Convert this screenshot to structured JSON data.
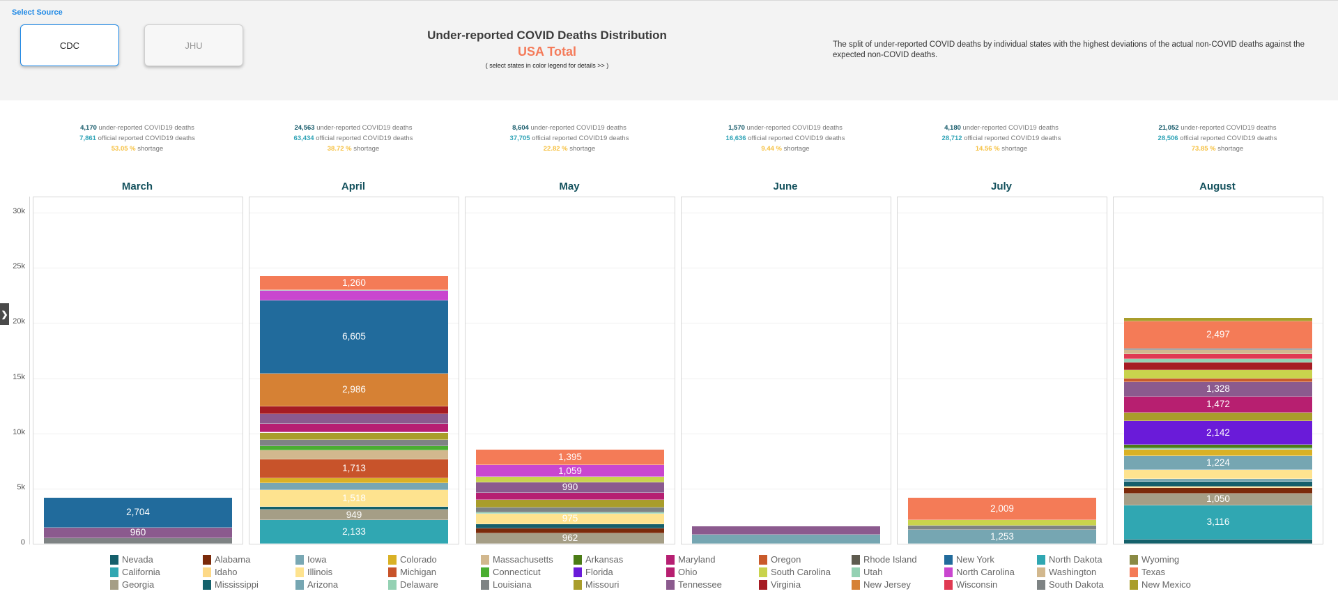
{
  "header": {
    "select_source_label": "Select Source",
    "sources": [
      {
        "label": "CDC",
        "selected": true
      },
      {
        "label": "JHU",
        "selected": false
      }
    ],
    "title": "Under-reported COVID Deaths Distribution",
    "subtitle": "USA Total",
    "hint": "( select states in color legend for details >> )",
    "description": "The split of under-reported COVID deaths by individual states with the highest deviations of the actual non-COVID deaths against the expected non-COVID deaths."
  },
  "stats_labels": {
    "under": "under-reported COVID19 deaths",
    "official": "official reported COVID19 deaths",
    "shortage": "shortage",
    "percent_sign": "%"
  },
  "months": [
    {
      "name": "March",
      "under": "4,170",
      "official": "7,861",
      "shortage_pct": "53.05"
    },
    {
      "name": "April",
      "under": "24,563",
      "official": "63,434",
      "shortage_pct": "38.72"
    },
    {
      "name": "May",
      "under": "8,604",
      "official": "37,705",
      "shortage_pct": "22.82"
    },
    {
      "name": "June",
      "under": "1,570",
      "official": "16,636",
      "shortage_pct": "9.44"
    },
    {
      "name": "July",
      "under": "4,180",
      "official": "28,712",
      "shortage_pct": "14.56"
    },
    {
      "name": "August",
      "under": "21,052",
      "official": "28,506",
      "shortage_pct": "73.85"
    }
  ],
  "side_toggle_icon": "chevron-right-icon",
  "colors": {
    "accent": "#1e88e5",
    "subtitle": "#f47b5a",
    "month_title": "#12505c",
    "under_value": "#155a6a",
    "official_value": "#2fa3b6",
    "shortage_value": "#f6c142"
  },
  "chart_data": {
    "type": "bar",
    "stacked": true,
    "title": "Under-reported COVID Deaths Distribution",
    "subtitle": "USA Total",
    "ylabel": "",
    "ylim": [
      0,
      31000
    ],
    "yticks": [
      0,
      5000,
      10000,
      15000,
      20000,
      25000,
      30000
    ],
    "ytick_labels": [
      "0",
      "5k",
      "10k",
      "15k",
      "20k",
      "25k",
      "30k"
    ],
    "grid": true,
    "categories": [
      "March",
      "April",
      "May",
      "June",
      "July",
      "August"
    ],
    "legend_placement": "bottom",
    "state_colors": {
      "Nevada": "#155f6b",
      "California": "#30a7b2",
      "Georgia": "#a59e86",
      "Alabama": "#7b2a0a",
      "Idaho": "#fdd987",
      "Mississippi": "#14616b",
      "Iowa": "#79a8b4",
      "Illinois": "#fee38f",
      "Arizona": "#76a6b2",
      "Colorado": "#d9b125",
      "Michigan": "#c8532a",
      "Delaware": "#94d1b3",
      "Massachusetts": "#d2b88e",
      "Connecticut": "#4aae31",
      "Louisiana": "#7e8384",
      "Arkansas": "#4b7c16",
      "Florida": "#6a1bd9",
      "Missouri": "#a99d2b",
      "Maryland": "#b61f72",
      "Ohio": "#b71f70",
      "Tennessee": "#8b5a8e",
      "Oregon": "#c95a2b",
      "South Carolina": "#c9d34d",
      "Virginia": "#a61c23",
      "Rhode Island": "#5e5b4f",
      "Utah": "#94d1b3",
      "New Jersey": "#d68134",
      "New York": "#216b9c",
      "North Carolina": "#c946cf",
      "Wisconsin": "#e03a52",
      "North Dakota": "#30a7b2",
      "Washington": "#d2b88e",
      "South Dakota": "#7e8384",
      "Wyoming": "#8a8a44",
      "Texas": "#f47b57",
      "New Mexico": "#a99d2b"
    },
    "legend": [
      [
        "Nevada",
        "California",
        "Georgia"
      ],
      [
        "Alabama",
        "Idaho",
        "Mississippi"
      ],
      [
        "Iowa",
        "Illinois",
        "Arizona"
      ],
      [
        "Colorado",
        "Michigan",
        "Delaware"
      ],
      [
        "Massachusetts",
        "Connecticut",
        "Louisiana"
      ],
      [
        "Arkansas",
        "Florida",
        "Missouri"
      ],
      [
        "Maryland",
        "Ohio",
        "Tennessee"
      ],
      [
        "Oregon",
        "South Carolina",
        "Virginia"
      ],
      [
        "Rhode Island",
        "Utah",
        "New Jersey"
      ],
      [
        "New York",
        "North Carolina",
        "Wisconsin"
      ],
      [
        "North Dakota",
        "Washington",
        "South Dakota"
      ],
      [
        "Wyoming",
        "Texas",
        "New Mexico"
      ]
    ],
    "stacks": [
      {
        "month": "March",
        "segments": [
          {
            "state": "Louisiana",
            "value": 506,
            "label": ""
          },
          {
            "state": "Tennessee",
            "value": 960,
            "label": "960"
          },
          {
            "state": "New York",
            "value": 2704,
            "label": "2,704"
          }
        ]
      },
      {
        "month": "April",
        "segments": [
          {
            "state": "California",
            "value": 2133,
            "label": "2,133"
          },
          {
            "state": "Georgia",
            "value": 949,
            "label": "949"
          },
          {
            "state": "Mississippi",
            "value": 250,
            "label": ""
          },
          {
            "state": "Illinois",
            "value": 1518,
            "label": "1,518"
          },
          {
            "state": "Arizona",
            "value": 620,
            "label": ""
          },
          {
            "state": "Colorado",
            "value": 480,
            "label": ""
          },
          {
            "state": "Michigan",
            "value": 1713,
            "label": "1,713"
          },
          {
            "state": "Massachusetts",
            "value": 780,
            "label": ""
          },
          {
            "state": "Connecticut",
            "value": 380,
            "label": ""
          },
          {
            "state": "Louisiana",
            "value": 600,
            "label": ""
          },
          {
            "state": "Missouri",
            "value": 650,
            "label": ""
          },
          {
            "state": "Maryland",
            "value": 820,
            "label": ""
          },
          {
            "state": "Tennessee",
            "value": 850,
            "label": ""
          },
          {
            "state": "Virginia",
            "value": 700,
            "label": ""
          },
          {
            "state": "New Jersey",
            "value": 2986,
            "label": "2,986"
          },
          {
            "state": "New York",
            "value": 6605,
            "label": "6,605"
          },
          {
            "state": "North Carolina",
            "value": 900,
            "label": ""
          },
          {
            "state": "Delaware",
            "value": 68,
            "label": ""
          },
          {
            "state": "Texas",
            "value": 1260,
            "label": "1,260"
          }
        ]
      },
      {
        "month": "May",
        "segments": [
          {
            "state": "Georgia",
            "value": 962,
            "label": "962"
          },
          {
            "state": "Alabama",
            "value": 420,
            "label": ""
          },
          {
            "state": "Nevada",
            "value": 380,
            "label": ""
          },
          {
            "state": "Illinois",
            "value": 975,
            "label": "975"
          },
          {
            "state": "Delaware",
            "value": 120,
            "label": ""
          },
          {
            "state": "Louisiana",
            "value": 450,
            "label": ""
          },
          {
            "state": "Missouri",
            "value": 660,
            "label": ""
          },
          {
            "state": "Maryland",
            "value": 630,
            "label": ""
          },
          {
            "state": "Tennessee",
            "value": 990,
            "label": "990"
          },
          {
            "state": "South Carolina",
            "value": 463,
            "label": ""
          },
          {
            "state": "North Carolina",
            "value": 1059,
            "label": "1,059"
          },
          {
            "state": "Texas",
            "value": 1395,
            "label": "1,395"
          }
        ]
      },
      {
        "month": "June",
        "segments": [
          {
            "state": "Arizona",
            "value": 820,
            "label": ""
          },
          {
            "state": "Tennessee",
            "value": 750,
            "label": ""
          }
        ]
      },
      {
        "month": "July",
        "segments": [
          {
            "state": "Arizona",
            "value": 1253,
            "label": "1,253"
          },
          {
            "state": "Louisiana",
            "value": 380,
            "label": ""
          },
          {
            "state": "South Carolina",
            "value": 538,
            "label": ""
          },
          {
            "state": "Texas",
            "value": 2009,
            "label": "2,009"
          }
        ]
      },
      {
        "month": "August",
        "segments": [
          {
            "state": "Mississippi",
            "value": 380,
            "label": ""
          },
          {
            "state": "California",
            "value": 3116,
            "label": "3,116"
          },
          {
            "state": "Georgia",
            "value": 1050,
            "label": "1,050"
          },
          {
            "state": "Alabama",
            "value": 520,
            "label": ""
          },
          {
            "state": "Idaho",
            "value": 120,
            "label": ""
          },
          {
            "state": "Nevada",
            "value": 420,
            "label": ""
          },
          {
            "state": "Iowa",
            "value": 260,
            "label": ""
          },
          {
            "state": "Illinois",
            "value": 860,
            "label": ""
          },
          {
            "state": "Arizona",
            "value": 1224,
            "label": "1,224"
          },
          {
            "state": "Colorado",
            "value": 560,
            "label": ""
          },
          {
            "state": "Delaware",
            "value": 120,
            "label": ""
          },
          {
            "state": "Arkansas",
            "value": 360,
            "label": ""
          },
          {
            "state": "Florida",
            "value": 2142,
            "label": "2,142"
          },
          {
            "state": "Missouri",
            "value": 750,
            "label": ""
          },
          {
            "state": "Ohio",
            "value": 1472,
            "label": "1,472"
          },
          {
            "state": "Tennessee",
            "value": 1328,
            "label": "1,328"
          },
          {
            "state": "Oregon",
            "value": 260,
            "label": ""
          },
          {
            "state": "South Carolina",
            "value": 790,
            "label": ""
          },
          {
            "state": "Virginia",
            "value": 660,
            "label": ""
          },
          {
            "state": "Utah",
            "value": 330,
            "label": ""
          },
          {
            "state": "Wisconsin",
            "value": 450,
            "label": ""
          },
          {
            "state": "Washington",
            "value": 400,
            "label": ""
          },
          {
            "state": "South Dakota",
            "value": 100,
            "label": ""
          },
          {
            "state": "Texas",
            "value": 2497,
            "label": "2,497"
          },
          {
            "state": "New Mexico",
            "value": 273,
            "label": ""
          }
        ]
      }
    ]
  }
}
